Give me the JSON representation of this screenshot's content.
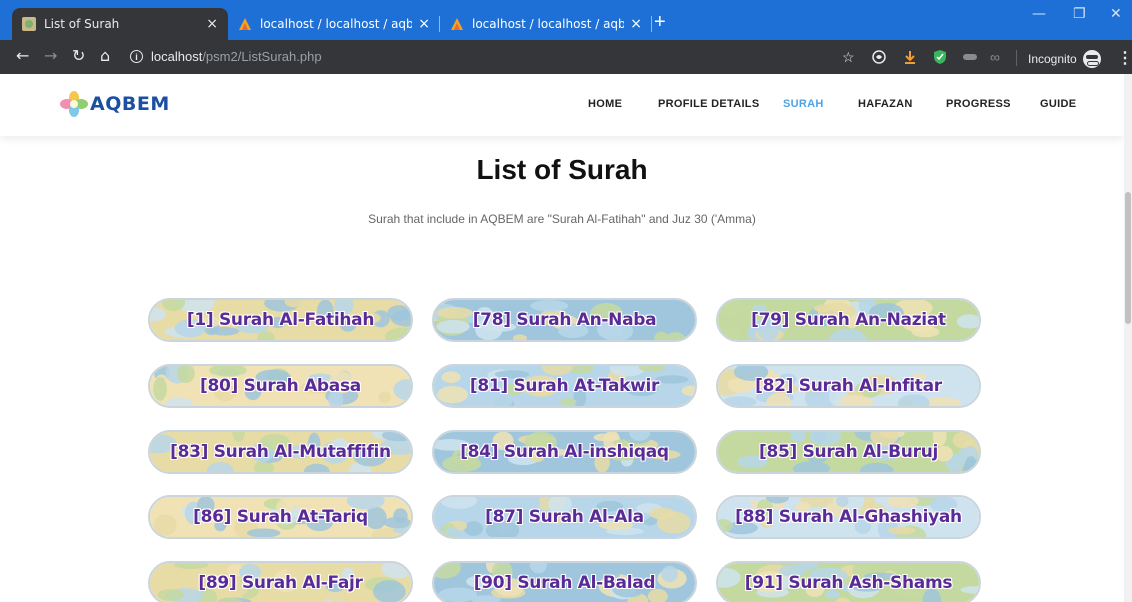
{
  "browser": {
    "tabs": [
      {
        "title": "List of Surah",
        "active": true
      },
      {
        "title": "localhost / localhost / aqbem / st",
        "active": false
      },
      {
        "title": "localhost / localhost / aqbem / st",
        "active": false
      }
    ],
    "close_glyph": "×",
    "new_tab_glyph": "+",
    "url_host": "localhost",
    "url_path": "/psm2/ListSurah.php",
    "incognito_label": "Incognito",
    "window_controls": [
      "—",
      "❐",
      "✕"
    ]
  },
  "header": {
    "logo_text": "AQBEM",
    "nav": [
      {
        "label": "HOME",
        "current": false
      },
      {
        "label": "PROFILE DETAILS",
        "current": false
      },
      {
        "label": "SURAH",
        "current": true
      },
      {
        "label": "HAFAZAN",
        "current": false
      },
      {
        "label": "PROGRESS",
        "current": false
      },
      {
        "label": "GUIDE",
        "current": false
      }
    ]
  },
  "main": {
    "title": "List of Surah",
    "subtitle": "Surah that include in AQBEM are \"Surah Al-Fatihah\" and Juz 30 ('Amma)",
    "surahs": [
      "[1] Surah Al-Fatihah",
      "[78] Surah An-Naba",
      "[79] Surah An-Naziat",
      "[80] Surah Abasa",
      "[81] Surah At-Takwir",
      "[82] Surah Al-Infitar",
      "[83] Surah Al-Mutaffifin",
      "[84] Surah Al-inshiqaq",
      "[85] Surah  Al-Buruj",
      "[86] Surah At-Tariq",
      "[87] Surah Al-Ala",
      "[88] Surah Al-Ghashiyah",
      "[89] Surah Al-Fajr",
      "[90] Surah Al-Balad",
      "[91] Surah Ash-Shams"
    ]
  },
  "colors": {
    "tabbar": "#1f70d6",
    "toolbar": "#35363a",
    "nav_active": "#4da3e6",
    "button_text": "#5a2b97"
  }
}
